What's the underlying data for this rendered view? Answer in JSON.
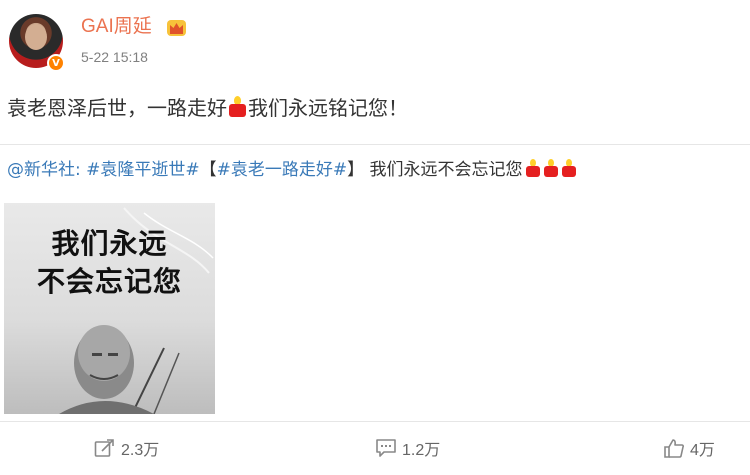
{
  "post": {
    "author": "GAI周延",
    "timestamp": "5-22 15:18",
    "text_part1": "袁老恩泽后世，一路走好",
    "text_part2": "我们永远铭记您！",
    "repost": {
      "mention": "@新华社:",
      "hashtag1": "#袁隆平逝世#",
      "bracket_open": "【",
      "hashtag2": "#袁老一路走好#",
      "bracket_close": "】",
      "text": " 我们永远不会忘记您"
    },
    "image": {
      "line1": "我们永远",
      "line2": "不会忘记您"
    }
  },
  "actions": {
    "repost_count": "2.3万",
    "comment_count": "1.2万",
    "like_count": "4万"
  },
  "colors": {
    "username": "#eb7350",
    "link": "#3a7ab8",
    "verified_badge": "#ff8200"
  },
  "icons": [
    "avatar",
    "verified-icon",
    "crown-icon",
    "candle-icon",
    "repost-icon",
    "comment-icon",
    "like-icon"
  ]
}
